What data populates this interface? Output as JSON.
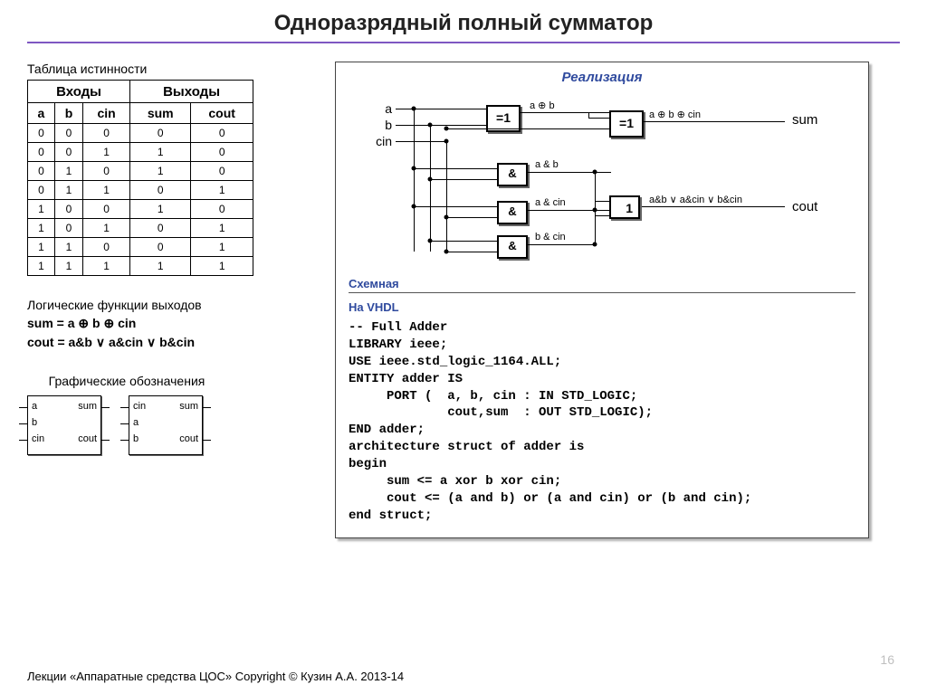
{
  "title": "Одноразрядный полный сумматор",
  "truth_table": {
    "label": "Таблица истинности",
    "group_inputs": "Входы",
    "group_outputs": "Выходы",
    "cols": [
      "a",
      "b",
      "cin",
      "sum",
      "cout"
    ],
    "rows": [
      [
        "0",
        "0",
        "0",
        "0",
        "0"
      ],
      [
        "0",
        "0",
        "1",
        "1",
        "0"
      ],
      [
        "0",
        "1",
        "0",
        "1",
        "0"
      ],
      [
        "0",
        "1",
        "1",
        "0",
        "1"
      ],
      [
        "1",
        "0",
        "0",
        "1",
        "0"
      ],
      [
        "1",
        "0",
        "1",
        "0",
        "1"
      ],
      [
        "1",
        "1",
        "0",
        "0",
        "1"
      ],
      [
        "1",
        "1",
        "1",
        "1",
        "1"
      ]
    ]
  },
  "logic": {
    "label": "Логические функции выходов",
    "sum_eq": "sum = a ⊕ b ⊕ cin",
    "cout_eq": "cout = a&b ∨ a&cin ∨ b&cin"
  },
  "symbols": {
    "label": "Графические обозначения",
    "block1": {
      "i1": "a",
      "i2": "b",
      "i3": "cin",
      "o1": "sum",
      "o2": "cout"
    },
    "block2": {
      "i1": "cin",
      "i2": "a",
      "i3": "b",
      "o1": "sum",
      "o2": "cout"
    }
  },
  "panel": {
    "realiz": "Реализация",
    "diagram": {
      "in_a": "a",
      "in_b": "b",
      "in_cin": "cin",
      "gate_xor": "=1",
      "gate_and": "&",
      "gate_or": "1",
      "w_axorb": "a ⊕ b",
      "w_axorbxorc": "a ⊕ b ⊕ cin",
      "w_ab": "a & b",
      "w_acin": "a & cin",
      "w_bcin": "b & cin",
      "w_or": "a&b ∨ a&cin ∨ b&cin",
      "out_sum": "sum",
      "out_cout": "cout"
    },
    "sub_schem": "Схемная",
    "sub_vhdl": "На VHDL",
    "code": "-- Full Adder\nLIBRARY ieee;\nUSE ieee.std_logic_1164.ALL;\nENTITY adder IS\n     PORT (  a, b, cin : IN STD_LOGIC;\n             cout,sum  : OUT STD_LOGIC);\nEND adder;\narchitecture struct of adder is\nbegin\n     sum <= a xor b xor cin;\n     cout <= (a and b) or (a and cin) or (b and cin);\nend struct;"
  },
  "footer": "Лекции «Аппаратные средства ЦОС» Copyright © Кузин А.А. 2013-14",
  "page": "16"
}
